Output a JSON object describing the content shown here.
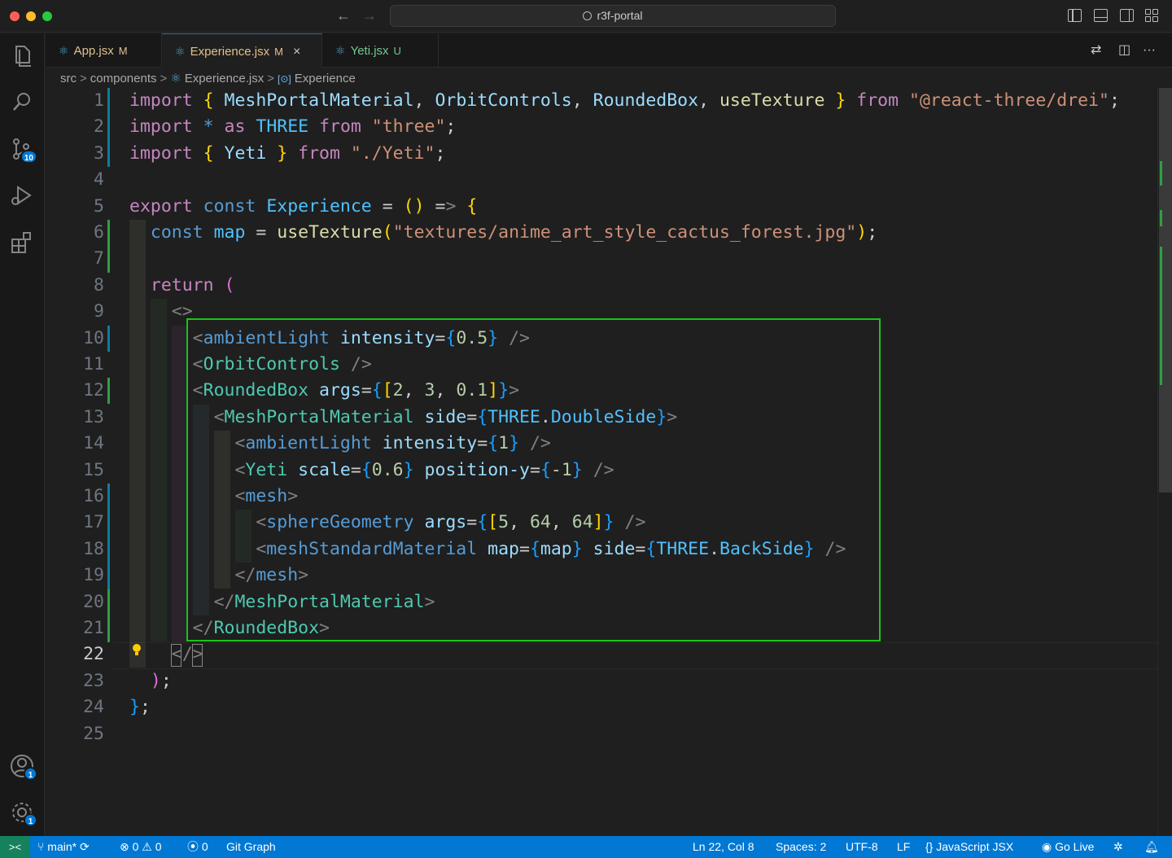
{
  "window": {
    "title": "r3f-portal"
  },
  "activity": {
    "source_control_badge": "10",
    "accounts_badge": "1",
    "settings_badge": "1"
  },
  "tabs": [
    {
      "label": "App.jsx",
      "mark": "M"
    },
    {
      "label": "Experience.jsx",
      "mark": "M",
      "close": "×"
    },
    {
      "label": "Yeti.jsx",
      "mark": "U"
    }
  ],
  "breadcrumb": {
    "seg1": "src",
    "seg2": "components",
    "seg3": "Experience.jsx",
    "seg4": "Experience",
    "sep": ">"
  },
  "editor": {
    "line_numbers": [
      "1",
      "2",
      "3",
      "4",
      "5",
      "6",
      "7",
      "8",
      "9",
      "10",
      "11",
      "12",
      "13",
      "14",
      "15",
      "16",
      "17",
      "18",
      "19",
      "20",
      "21",
      "22",
      "23",
      "24",
      "25"
    ],
    "lines": [
      "import { MeshPortalMaterial, OrbitControls, RoundedBox, useTexture } from \"@react-three/drei\";",
      "import * as THREE from \"three\";",
      "import { Yeti } from \"./Yeti\";",
      "",
      "export const Experience = () => {",
      "  const map = useTexture(\"textures/anime_art_style_cactus_forest.jpg\");",
      "",
      "  return (",
      "    <>",
      "      <ambientLight intensity={0.5} />",
      "      <OrbitControls />",
      "      <RoundedBox args={[2, 3, 0.1]}>",
      "        <MeshPortalMaterial side={THREE.DoubleSide}>",
      "          <ambientLight intensity={1} />",
      "          <Yeti scale={0.6} position-y={-1} />",
      "          <mesh>",
      "            <sphereGeometry args={[5, 64, 64]} />",
      "            <meshStandardMaterial map={map} side={THREE.BackSide} />",
      "          </mesh>",
      "        </MeshPortalMaterial>",
      "      </RoundedBox>",
      "    </>",
      "  );",
      "};",
      ""
    ]
  },
  "status": {
    "branch": "main*",
    "errors": "0",
    "warnings": "0",
    "ports": "0",
    "git_graph": "Git Graph",
    "cursor": "Ln 22, Col 8",
    "spaces": "Spaces: 2",
    "encoding": "UTF-8",
    "eol": "LF",
    "language": "JavaScript JSX",
    "go_live": "Go Live"
  },
  "colors": {
    "accent": "#0078d4",
    "highlight_box": "#19c419",
    "remote": "#16825d"
  }
}
